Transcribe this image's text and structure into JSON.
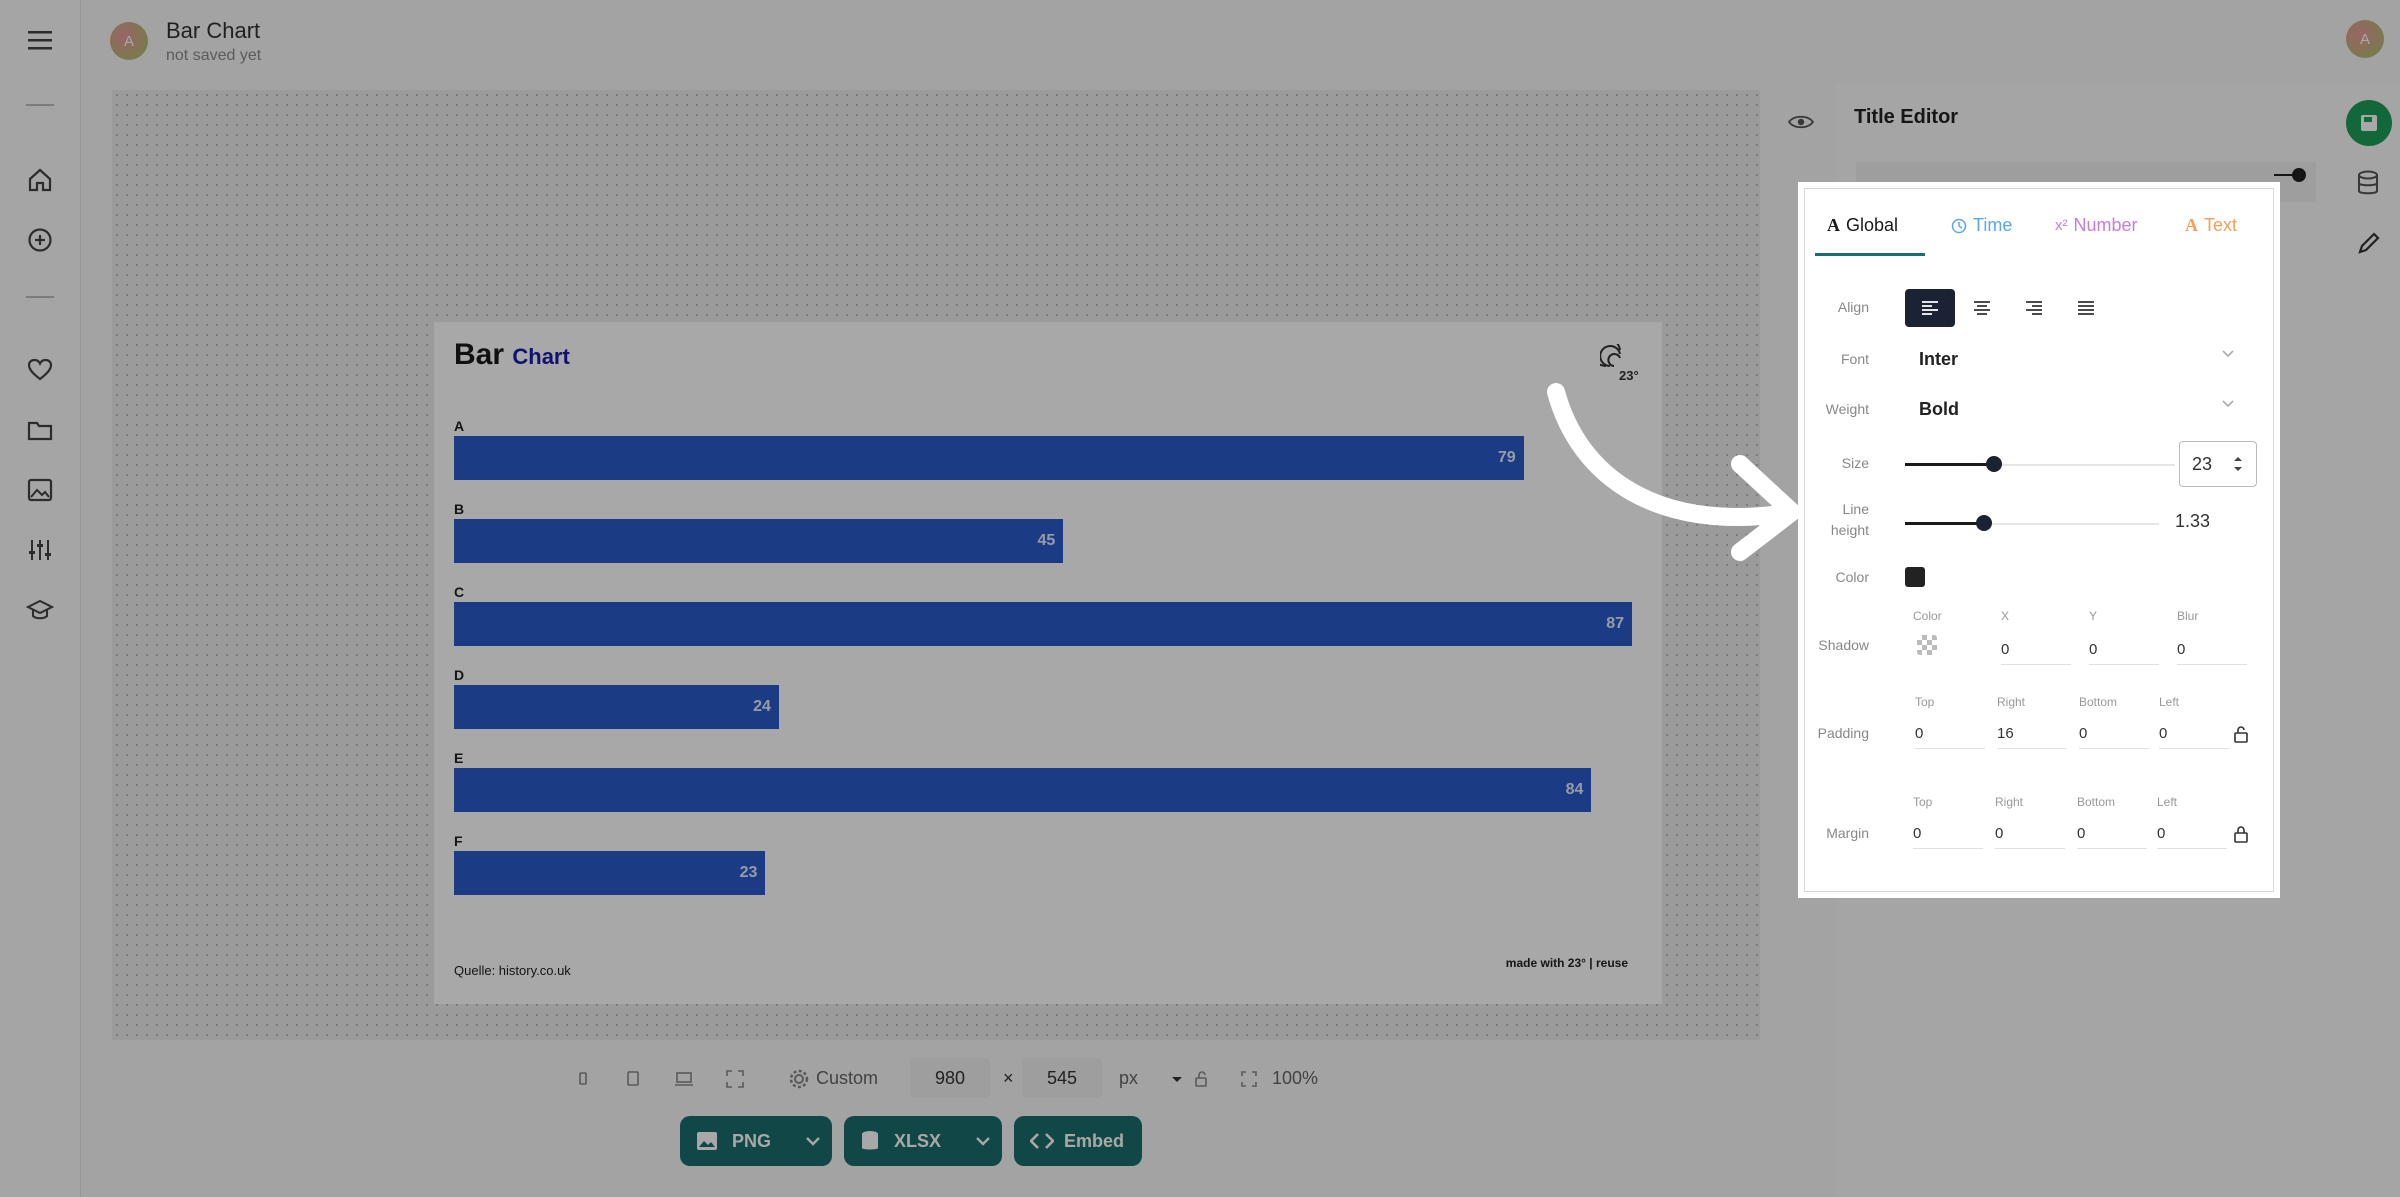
{
  "header": {
    "avatar_initial": "A",
    "title": "Bar Chart",
    "subtitle": "not saved yet",
    "user_initial": "A"
  },
  "chart_data": {
    "type": "bar",
    "title": "Bar",
    "title_accent": "Chart",
    "categories": [
      "A",
      "B",
      "C",
      "D",
      "E",
      "F"
    ],
    "values": [
      79,
      45,
      87,
      24,
      84,
      23
    ],
    "xlim": [
      0,
      87
    ],
    "orientation": "horizontal",
    "bar_color": "#2a5cc9",
    "source": "Quelle: history.co.uk",
    "footer": "made with 23° | reuse",
    "logo_text": "23°"
  },
  "bottom_toolbar": {
    "preset_label": "Custom",
    "width": "980",
    "times": "×",
    "height": "545",
    "unit": "px",
    "zoom": "100%"
  },
  "export": {
    "png": "PNG",
    "xlsx": "XLSX",
    "embed": "Embed"
  },
  "side_panel": {
    "title": "Title Editor"
  },
  "editor": {
    "tabs": [
      {
        "label": "Global",
        "icon": "A",
        "color": "#1a1a1a"
      },
      {
        "label": "Time",
        "icon": "clock-icon",
        "color": "#5aa9e6"
      },
      {
        "label": "Number",
        "icon": "x²",
        "color": "#c77dda"
      },
      {
        "label": "Text",
        "icon": "A",
        "color": "#f0a05a"
      }
    ],
    "align_label": "Align",
    "font_label": "Font",
    "font_value": "Inter",
    "weight_label": "Weight",
    "weight_value": "Bold",
    "size_label": "Size",
    "size_value": "23",
    "line_label_1": "Line",
    "line_label_2": "height",
    "line_value": "1.33",
    "color_label": "Color",
    "color_value": "#222222",
    "shadow": {
      "label": "Shadow",
      "cap_color": "Color",
      "cap_x": "X",
      "cap_y": "Y",
      "cap_blur": "Blur",
      "x": "0",
      "y": "0",
      "blur": "0"
    },
    "padding": {
      "label": "Padding",
      "cap_top": "Top",
      "cap_right": "Right",
      "cap_bottom": "Bottom",
      "cap_left": "Left",
      "top": "0",
      "right": "16",
      "bottom": "0",
      "left": "0"
    },
    "margin": {
      "label": "Margin",
      "cap_top": "Top",
      "cap_right": "Right",
      "cap_bottom": "Bottom",
      "cap_left": "Left",
      "top": "0",
      "right": "0",
      "bottom": "0",
      "left": "0"
    }
  }
}
